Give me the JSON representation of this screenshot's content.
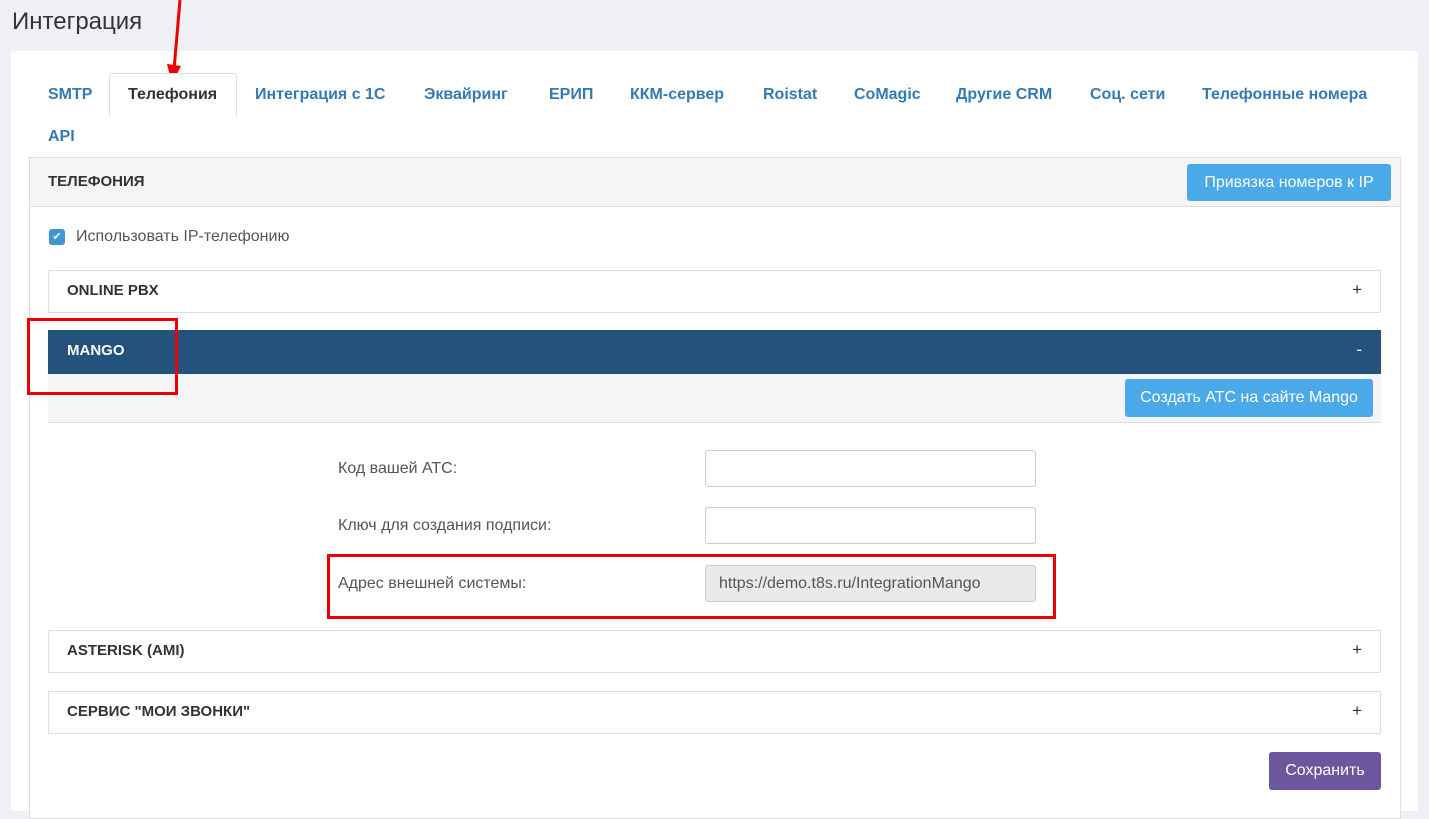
{
  "page": {
    "title": "Интеграция"
  },
  "tabs": [
    {
      "label": "SMTP"
    },
    {
      "label": "Телефония"
    },
    {
      "label": "Интеграция с 1С"
    },
    {
      "label": "Эквайринг"
    },
    {
      "label": "ЕРИП"
    },
    {
      "label": "ККМ-сервер"
    },
    {
      "label": "Roistat"
    },
    {
      "label": "CoMagic"
    },
    {
      "label": "Другие CRM"
    },
    {
      "label": "Соц. сети"
    },
    {
      "label": "Телефонные номера"
    },
    {
      "label": "API"
    }
  ],
  "active_tab": "Телефония",
  "panel": {
    "title": "ТЕЛЕФОНИЯ",
    "bind_numbers_button": "Привязка номеров к IP",
    "use_ip_telephony": {
      "label": "Использовать IP-телефонию",
      "checked": true
    }
  },
  "sections": [
    {
      "title": "ONLINE PBX",
      "toggle": "+"
    },
    {
      "title": "MANGO",
      "toggle": "-"
    },
    {
      "title": "ASTERISK (AMI)",
      "toggle": "+"
    },
    {
      "title": "СЕРВИС \"МОИ ЗВОНКИ\"",
      "toggle": "+"
    }
  ],
  "mango": {
    "create_button": "Создать АТС на сайте Mango",
    "fields": [
      {
        "label": "Код вашей АТС:",
        "value": ""
      },
      {
        "label": "Ключ для создания подписи:",
        "value": ""
      },
      {
        "label": "Адрес внешней системы:",
        "value": "https://demo.t8s.ru/IntegrationMango"
      }
    ]
  },
  "save_button": "Сохранить",
  "colors": {
    "tab_link": "#337ab7",
    "active_section": "#23527c",
    "info_button": "#4aa9e9",
    "save_button": "#6c579f",
    "annotation": "#ee0000"
  }
}
